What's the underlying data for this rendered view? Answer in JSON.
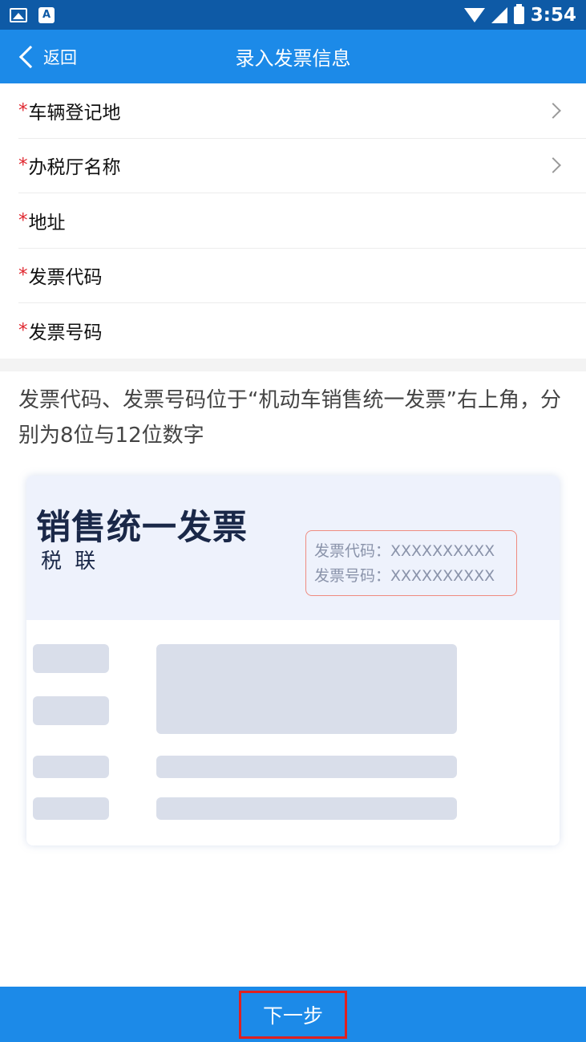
{
  "status_bar": {
    "time": "3:54",
    "notification_icons": [
      "image-icon",
      "a-icon"
    ],
    "system_icons": [
      "wifi-icon",
      "signal-icon",
      "battery-icon"
    ]
  },
  "nav": {
    "back_label": "返回",
    "title": "录入发票信息"
  },
  "form": {
    "required_mark": "*",
    "fields": [
      {
        "label": "车辆登记地",
        "has_chevron": true
      },
      {
        "label": "办税厅名称",
        "has_chevron": true
      },
      {
        "label": "地址",
        "has_chevron": false
      },
      {
        "label": "发票代码",
        "has_chevron": false
      },
      {
        "label": "发票号码",
        "has_chevron": false
      }
    ]
  },
  "hint": "发票代码、发票号码位于“机动车销售统一发票”右上角，分别为8位与12位数字",
  "invoice_sample": {
    "title": "销售统一发票",
    "subtitle": "税 联",
    "code_line": "发票代码：XXXXXXXXXX",
    "number_line": "发票号码：XXXXXXXXXX"
  },
  "footer": {
    "next_label": "下一步"
  },
  "colors": {
    "status_bar": "#0e5aa6",
    "primary": "#1c8ae8",
    "required": "#e0262e",
    "highlight_box": "#e02020"
  }
}
